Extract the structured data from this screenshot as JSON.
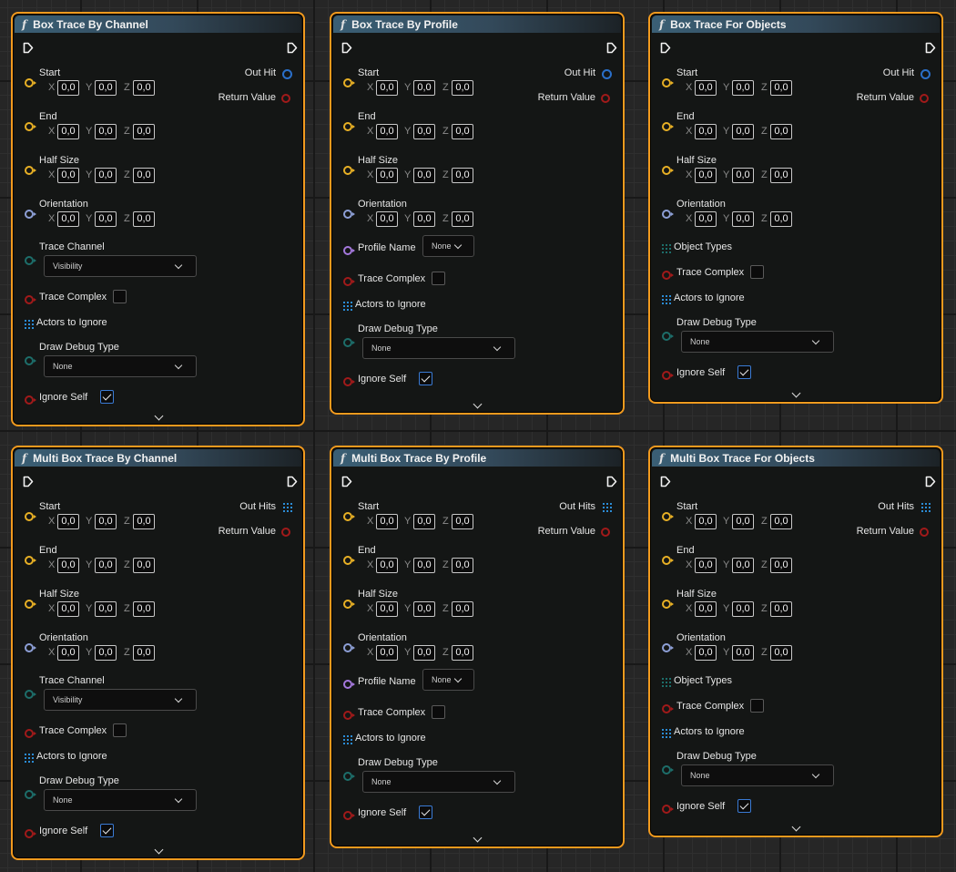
{
  "nodes": [
    {
      "title": "Box Trace By Channel",
      "outputs": [
        "Out Hit",
        "Return Value"
      ],
      "out_hit_type": "struct",
      "vectors": [
        {
          "label": "Start",
          "x": "0,0",
          "y": "0,0",
          "z": "0,0"
        },
        {
          "label": "End",
          "x": "0,0",
          "y": "0,0",
          "z": "0,0"
        },
        {
          "label": "Half Size",
          "x": "0,0",
          "y": "0,0",
          "z": "0,0"
        },
        {
          "label": "Orientation",
          "x": "0,0",
          "y": "0,0",
          "z": "0,0"
        }
      ],
      "extra_rows": [
        {
          "kind": "dropdown",
          "label": "Trace Channel",
          "value": "Visibility"
        },
        {
          "kind": "checkbox",
          "label": "Trace Complex",
          "checked": false
        },
        {
          "kind": "array",
          "label": "Actors to Ignore"
        },
        {
          "kind": "dropdown",
          "label": "Draw Debug Type",
          "value": "None"
        },
        {
          "kind": "checkbox",
          "label": "Ignore Self",
          "checked": true
        }
      ]
    },
    {
      "title": "Box Trace By Profile",
      "outputs": [
        "Out Hit",
        "Return Value"
      ],
      "out_hit_type": "struct",
      "vectors": [
        {
          "label": "Start",
          "x": "0,0",
          "y": "0,0",
          "z": "0,0"
        },
        {
          "label": "End",
          "x": "0,0",
          "y": "0,0",
          "z": "0,0"
        },
        {
          "label": "Half Size",
          "x": "0,0",
          "y": "0,0",
          "z": "0,0"
        },
        {
          "label": "Orientation",
          "x": "0,0",
          "y": "0,0",
          "z": "0,0"
        }
      ],
      "extra_rows": [
        {
          "kind": "name",
          "label": "Profile Name",
          "value": "None"
        },
        {
          "kind": "checkbox",
          "label": "Trace Complex",
          "checked": false
        },
        {
          "kind": "array",
          "label": "Actors to Ignore"
        },
        {
          "kind": "dropdown",
          "label": "Draw Debug Type",
          "value": "None"
        },
        {
          "kind": "checkbox",
          "label": "Ignore Self",
          "checked": true
        }
      ]
    },
    {
      "title": "Box Trace For Objects",
      "outputs": [
        "Out Hit",
        "Return Value"
      ],
      "out_hit_type": "struct",
      "vectors": [
        {
          "label": "Start",
          "x": "0,0",
          "y": "0,0",
          "z": "0,0"
        },
        {
          "label": "End",
          "x": "0,0",
          "y": "0,0",
          "z": "0,0"
        },
        {
          "label": "Half Size",
          "x": "0,0",
          "y": "0,0",
          "z": "0,0"
        },
        {
          "label": "Orientation",
          "x": "0,0",
          "y": "0,0",
          "z": "0,0"
        }
      ],
      "extra_rows": [
        {
          "kind": "objtypes",
          "label": "Object Types"
        },
        {
          "kind": "checkbox",
          "label": "Trace Complex",
          "checked": false
        },
        {
          "kind": "array",
          "label": "Actors to Ignore"
        },
        {
          "kind": "dropdown",
          "label": "Draw Debug Type",
          "value": "None"
        },
        {
          "kind": "checkbox",
          "label": "Ignore Self",
          "checked": true
        }
      ]
    },
    {
      "title": "Multi Box Trace By Channel",
      "outputs": [
        "Out Hits",
        "Return Value"
      ],
      "out_hit_type": "array",
      "vectors": [
        {
          "label": "Start",
          "x": "0,0",
          "y": "0,0",
          "z": "0,0"
        },
        {
          "label": "End",
          "x": "0,0",
          "y": "0,0",
          "z": "0,0"
        },
        {
          "label": "Half Size",
          "x": "0,0",
          "y": "0,0",
          "z": "0,0"
        },
        {
          "label": "Orientation",
          "x": "0,0",
          "y": "0,0",
          "z": "0,0"
        }
      ],
      "extra_rows": [
        {
          "kind": "dropdown",
          "label": "Trace Channel",
          "value": "Visibility"
        },
        {
          "kind": "checkbox",
          "label": "Trace Complex",
          "checked": false
        },
        {
          "kind": "array",
          "label": "Actors to Ignore"
        },
        {
          "kind": "dropdown",
          "label": "Draw Debug Type",
          "value": "None"
        },
        {
          "kind": "checkbox",
          "label": "Ignore Self",
          "checked": true
        }
      ]
    },
    {
      "title": "Multi Box Trace By Profile",
      "outputs": [
        "Out Hits",
        "Return Value"
      ],
      "out_hit_type": "array",
      "vectors": [
        {
          "label": "Start",
          "x": "0,0",
          "y": "0,0",
          "z": "0,0"
        },
        {
          "label": "End",
          "x": "0,0",
          "y": "0,0",
          "z": "0,0"
        },
        {
          "label": "Half Size",
          "x": "0,0",
          "y": "0,0",
          "z": "0,0"
        },
        {
          "label": "Orientation",
          "x": "0,0",
          "y": "0,0",
          "z": "0,0"
        }
      ],
      "extra_rows": [
        {
          "kind": "name",
          "label": "Profile Name",
          "value": "None"
        },
        {
          "kind": "checkbox",
          "label": "Trace Complex",
          "checked": false
        },
        {
          "kind": "array",
          "label": "Actors to Ignore"
        },
        {
          "kind": "dropdown",
          "label": "Draw Debug Type",
          "value": "None"
        },
        {
          "kind": "checkbox",
          "label": "Ignore Self",
          "checked": true
        }
      ]
    },
    {
      "title": "Multi Box Trace For Objects",
      "outputs": [
        "Out Hits",
        "Return Value"
      ],
      "out_hit_type": "array",
      "vectors": [
        {
          "label": "Start",
          "x": "0,0",
          "y": "0,0",
          "z": "0,0"
        },
        {
          "label": "End",
          "x": "0,0",
          "y": "0,0",
          "z": "0,0"
        },
        {
          "label": "Half Size",
          "x": "0,0",
          "y": "0,0",
          "z": "0,0"
        },
        {
          "label": "Orientation",
          "x": "0,0",
          "y": "0,0",
          "z": "0,0"
        }
      ],
      "extra_rows": [
        {
          "kind": "objtypes",
          "label": "Object Types"
        },
        {
          "kind": "checkbox",
          "label": "Trace Complex",
          "checked": false
        },
        {
          "kind": "array",
          "label": "Actors to Ignore"
        },
        {
          "kind": "dropdown",
          "label": "Draw Debug Type",
          "value": "None"
        },
        {
          "kind": "checkbox",
          "label": "Ignore Self",
          "checked": true
        }
      ]
    }
  ],
  "axis_labels": [
    "X",
    "Y",
    "Z"
  ],
  "icons": {
    "function": "function-icon",
    "exec": "exec-pin-icon",
    "array": "array-grid-icon",
    "expand": "chevron-down-icon"
  },
  "colors": {
    "node_border": "#f29a1e",
    "vector_pin": "#e8b025",
    "rotator_pin": "#8d9fd6",
    "enum_pin": "#1d6e6a",
    "bool_pin": "#a11a1a",
    "name_pin": "#a478dc",
    "struct_out": "#2a6fc9",
    "array_pin": "#2b8cd6"
  }
}
